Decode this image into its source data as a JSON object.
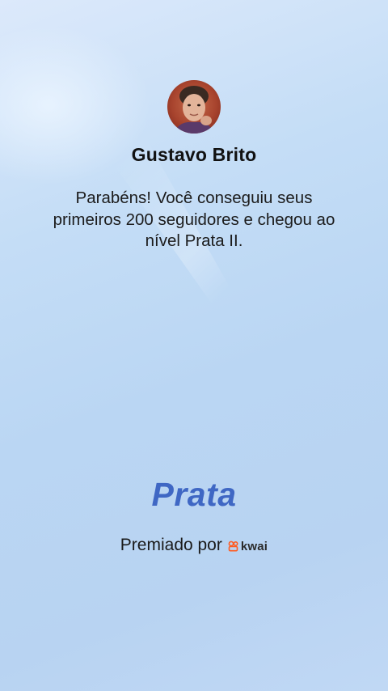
{
  "profile": {
    "name": "Gustavo Brito"
  },
  "message": {
    "text": "Parabéns! Você conseguiu seus primeiros 200 seguidores e chegou ao nível Prata II."
  },
  "badge": {
    "title": "Prata",
    "color": "#3f67c4"
  },
  "footer": {
    "awarded_by": "Premiado por",
    "brand": "kwai",
    "brand_icon": "kwai-logo-icon",
    "brand_icon_color": "#ff5a1f"
  }
}
